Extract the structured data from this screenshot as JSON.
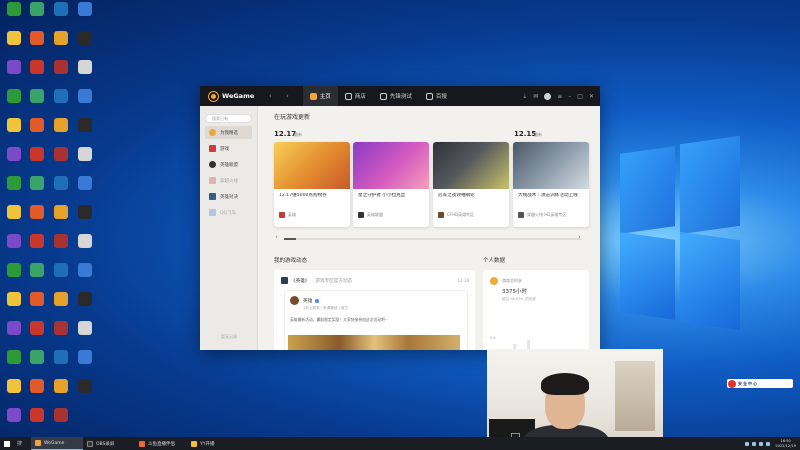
{
  "wegame": {
    "logo": "WeGame",
    "tabs": [
      {
        "label": "主页",
        "icon": "home-icon",
        "color": "#f0a43a"
      },
      {
        "label": "商店",
        "icon": "store-icon",
        "color": "#cfcfcf"
      },
      {
        "label": "先锋测试",
        "icon": "test-icon",
        "color": "#cfcfcf"
      },
      {
        "label": "百搜",
        "icon": "search-hundred-icon",
        "color": "#cfcfcf"
      }
    ],
    "sidebar": {
      "search_placeholder": "搜索已有",
      "items": [
        {
          "label": "为我精选",
          "active": true,
          "color": "#f0a43a"
        },
        {
          "label": "游戏",
          "active": false,
          "color": "#d23a3a"
        },
        {
          "label": "英雄联盟",
          "active": false,
          "color": "#333"
        },
        {
          "label": "穿越火线",
          "active": false,
          "dim": true,
          "color": "#e0b3b3"
        },
        {
          "label": "英雄对决",
          "active": false,
          "color": "#3a5a8a"
        },
        {
          "label": "QQ飞车",
          "active": false,
          "dim": true,
          "color": "#b3c8e0"
        }
      ],
      "footer": "暂无记录"
    },
    "updates": {
      "section_title": "在玩游戏更新",
      "date_1": "12.17",
      "date_1_tag": "最新",
      "date_2": "12.15",
      "date_2_tag": "最新",
      "cards": [
        {
          "title": "12.17维5000点购物券",
          "game": "英雄",
          "art": [
            "#f0c04a",
            "#d9772e"
          ],
          "icon_color": "#c43a3a"
        },
        {
          "title": "星之守护者 小小拉克丝",
          "game": "英雄联盟",
          "art": [
            "#b04ad6",
            "#f07aa8"
          ],
          "icon_color": "#333"
        },
        {
          "title": "冠军之夜领袖钢轮",
          "game": "CFHD英雄专区",
          "art": [
            "#3a3d42",
            "#c8c36a"
          ],
          "icon_color": "#6a4a2a"
        },
        {
          "title": "大线战术｜攻击训练活动上线",
          "game": "穿越火线·HD英雄专区",
          "art": [
            "#5a6a7a",
            "#c8cfd6"
          ],
          "icon_color": "#555"
        }
      ]
    },
    "feed": {
      "section_title": "我的游戏动态",
      "source": "《英雄》",
      "source_sub": "游戏专区官方动态",
      "date": "12-18",
      "post_author": "英雄",
      "post_time": "1天上前发 | 来源微信 | 官方",
      "post_text": "英雄最新活动，赢取限定奖励！大家快来参加这次活动吧~"
    },
    "stats": {
      "section_title": "个人数据",
      "label": "游戏总时长",
      "value": "3375小时",
      "percent": "超过 96.85% 的玩家",
      "zero_label": "0%"
    }
  },
  "taskbar": {
    "search": "搜",
    "items": [
      {
        "label": "WeGame",
        "active": true,
        "color": "#f0a43a"
      },
      {
        "label": "OBS录屏",
        "active": false,
        "color": "#333"
      },
      {
        "label": "斗鱼直播伴侣",
        "active": false,
        "color": "#f06a2a"
      },
      {
        "label": "YY开播",
        "active": false,
        "color": "#f0c03a"
      }
    ],
    "time": "16:50",
    "date": "2022/12/19"
  },
  "overlay": {
    "mini_text": "安全中心"
  }
}
